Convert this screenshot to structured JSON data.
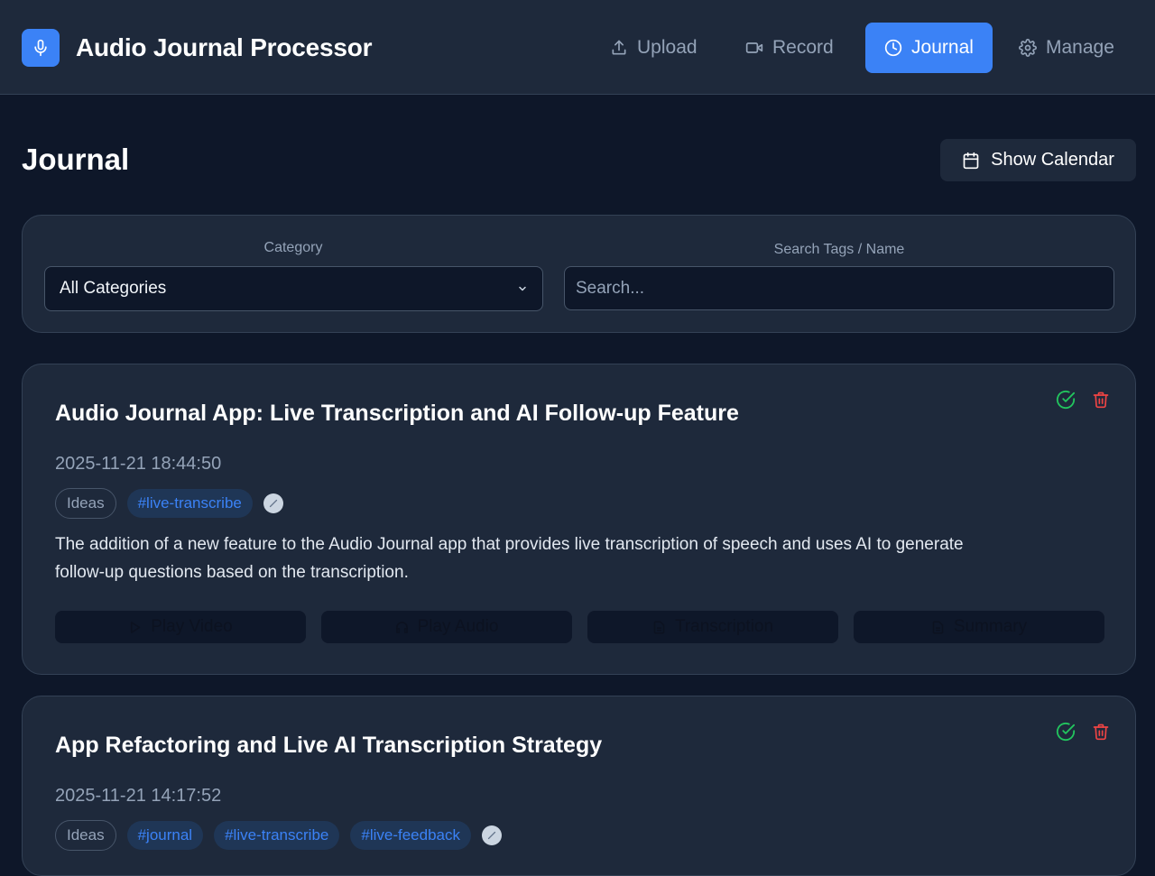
{
  "app": {
    "title": "Audio Journal Processor",
    "logo_icon": "microphone-icon",
    "accent": "#3b82f6"
  },
  "nav": {
    "upload": "Upload",
    "record": "Record",
    "journal": "Journal",
    "manage": "Manage",
    "active": "Journal"
  },
  "page": {
    "title": "Journal",
    "calendar_button": "Show Calendar"
  },
  "filters": {
    "category_label": "Category",
    "category_value": "All Categories",
    "search_label": "Search Tags / Name",
    "search_placeholder": "Search..."
  },
  "entries": [
    {
      "title": "Audio Journal App: Live Transcription and AI Follow-up Feature",
      "date": "2025-11-21 18:44:50",
      "category": "Ideas",
      "tags": [
        "#live-transcribe"
      ],
      "description": "The addition of a new feature to the Audio Journal app that provides live transcription of speech and uses AI to generate follow-up questions based on the transcription.",
      "actions": {
        "play_video": "Play Video",
        "play_audio": "Play Audio",
        "transcription": "Transcription",
        "summary": "Summary"
      }
    },
    {
      "title": "App Refactoring and Live AI Transcription Strategy",
      "date": "2025-11-21 14:17:52",
      "category": "Ideas",
      "tags": [
        "#journal",
        "#live-transcribe",
        "#live-feedback"
      ]
    }
  ]
}
